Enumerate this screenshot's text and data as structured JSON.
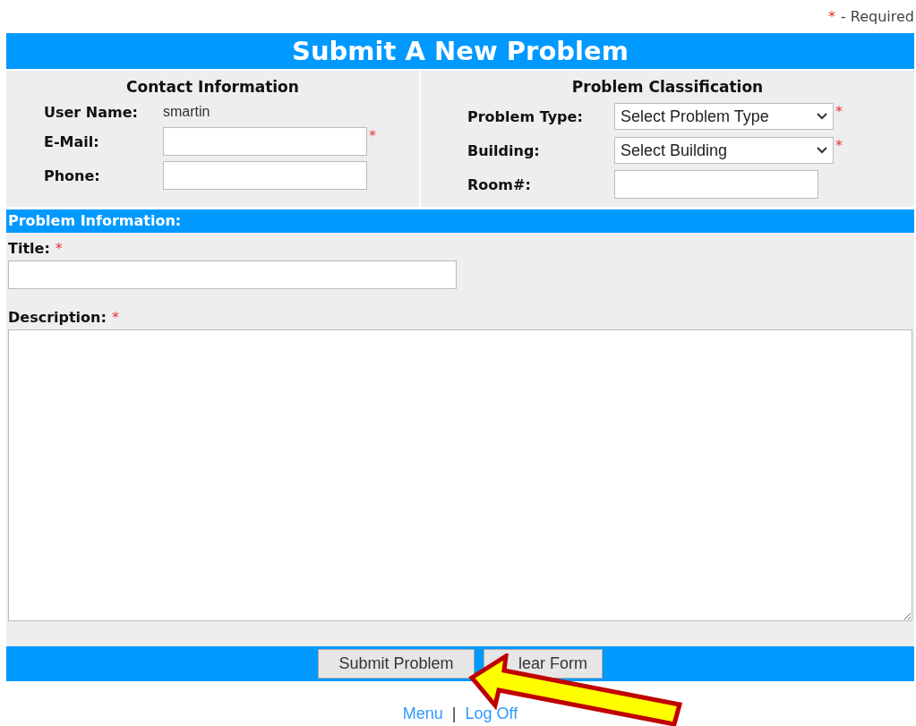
{
  "required_note": {
    "mark": "*",
    "text": "- Required"
  },
  "title": "Submit A New Problem",
  "contact": {
    "heading": "Contact Information",
    "user_label": "User Name:",
    "user_value": "smartin",
    "fields": [
      {
        "label": "E-Mail:",
        "required": true
      },
      {
        "label": "Phone:",
        "required": false
      }
    ]
  },
  "classification": {
    "heading": "Problem Classification",
    "fields": [
      {
        "label": "Problem Type:",
        "kind": "select",
        "value": "Select Problem Type",
        "required": true
      },
      {
        "label": "Building:",
        "kind": "select",
        "value": "Select Building",
        "required": true
      },
      {
        "label": "Room#:",
        "kind": "text",
        "required": false
      }
    ]
  },
  "problem_info": {
    "heading": "Problem Information:",
    "title_label": "Title:",
    "title_required": true,
    "description_label": "Description:",
    "description_required": true
  },
  "buttons": [
    "Submit Problem",
    "lear Form"
  ],
  "links": [
    "Menu",
    "Log Off"
  ],
  "separator": "|"
}
